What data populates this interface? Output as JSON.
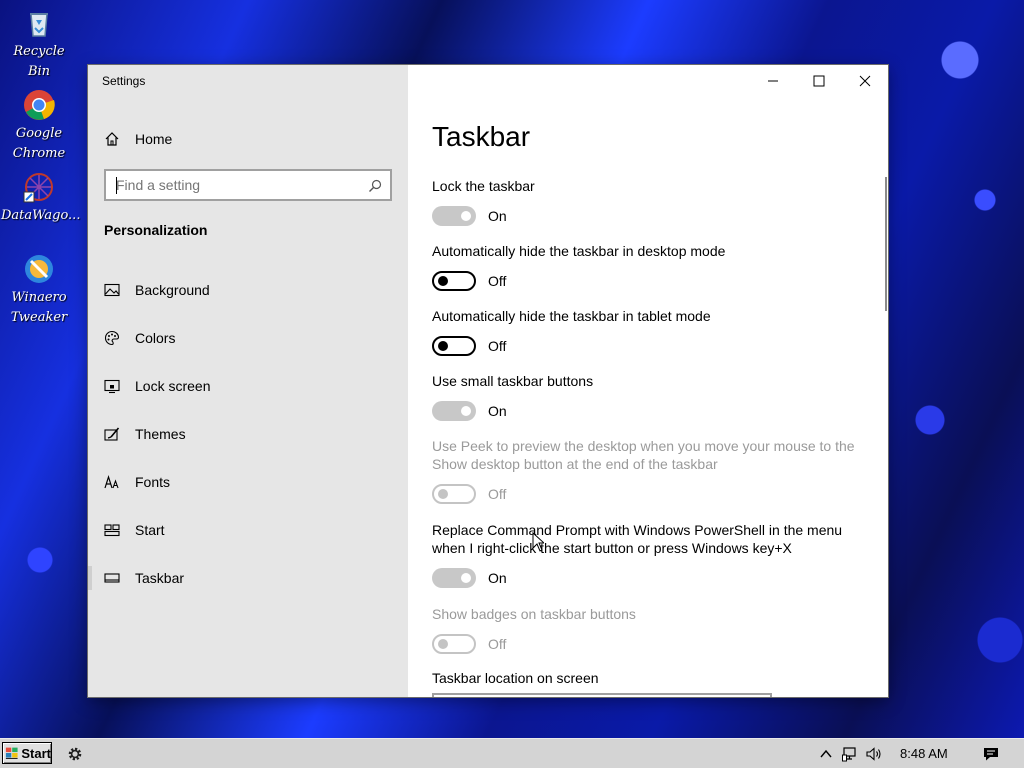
{
  "desktop": {
    "icons": [
      {
        "label": "Recycle Bin",
        "icon": "recycle-bin-icon"
      },
      {
        "label": "Google Chrome",
        "icon": "chrome-icon"
      },
      {
        "label": "DataWago...",
        "icon": "datawagon-icon"
      },
      {
        "label": "Winaero Tweaker",
        "icon": "winaero-tweaker-icon"
      }
    ]
  },
  "window": {
    "title": "Settings",
    "caption": {
      "minimize": "minimize-icon",
      "maximize": "maximize-icon",
      "close": "close-icon"
    }
  },
  "sidebar": {
    "home_label": "Home",
    "search_placeholder": "Find a setting",
    "section_heading": "Personalization",
    "items": [
      {
        "label": "Background",
        "icon": "background-icon"
      },
      {
        "label": "Colors",
        "icon": "palette-icon"
      },
      {
        "label": "Lock screen",
        "icon": "lock-screen-icon"
      },
      {
        "label": "Themes",
        "icon": "themes-icon"
      },
      {
        "label": "Fonts",
        "icon": "fonts-icon"
      },
      {
        "label": "Start",
        "icon": "start-icon"
      },
      {
        "label": "Taskbar",
        "icon": "taskbar-icon",
        "selected": true
      }
    ]
  },
  "content": {
    "page_title": "Taskbar",
    "settings": [
      {
        "label": "Lock the taskbar",
        "state": "On",
        "enabled": true
      },
      {
        "label": "Automatically hide the taskbar in desktop mode",
        "state": "Off",
        "enabled": true
      },
      {
        "label": "Automatically hide the taskbar in tablet mode",
        "state": "Off",
        "enabled": true
      },
      {
        "label": "Use small taskbar buttons",
        "state": "On",
        "enabled": true
      },
      {
        "label_line1": "Use Peek to preview the desktop when you move your mouse to the",
        "label_line2": "Show desktop button at the end of the taskbar",
        "state": "Off",
        "enabled": false
      },
      {
        "label_line1": "Replace Command Prompt with Windows PowerShell in the menu",
        "label_line2": "when I right-click the start button or press Windows key+X",
        "state": "On",
        "enabled": true
      },
      {
        "label": "Show badges on taskbar buttons",
        "state": "Off",
        "enabled": false
      }
    ],
    "location_label": "Taskbar location on screen"
  },
  "taskbar": {
    "start_label": "Start",
    "clock": "8:48 AM",
    "tray": [
      "chevron-up-icon",
      "network-icon",
      "volume-icon",
      "notification-icon"
    ]
  },
  "colors": {
    "accent_on_track": "#c8c8c8",
    "sidebar_bg": "#e6e6e6",
    "disabled_text": "#9a9a9a"
  }
}
